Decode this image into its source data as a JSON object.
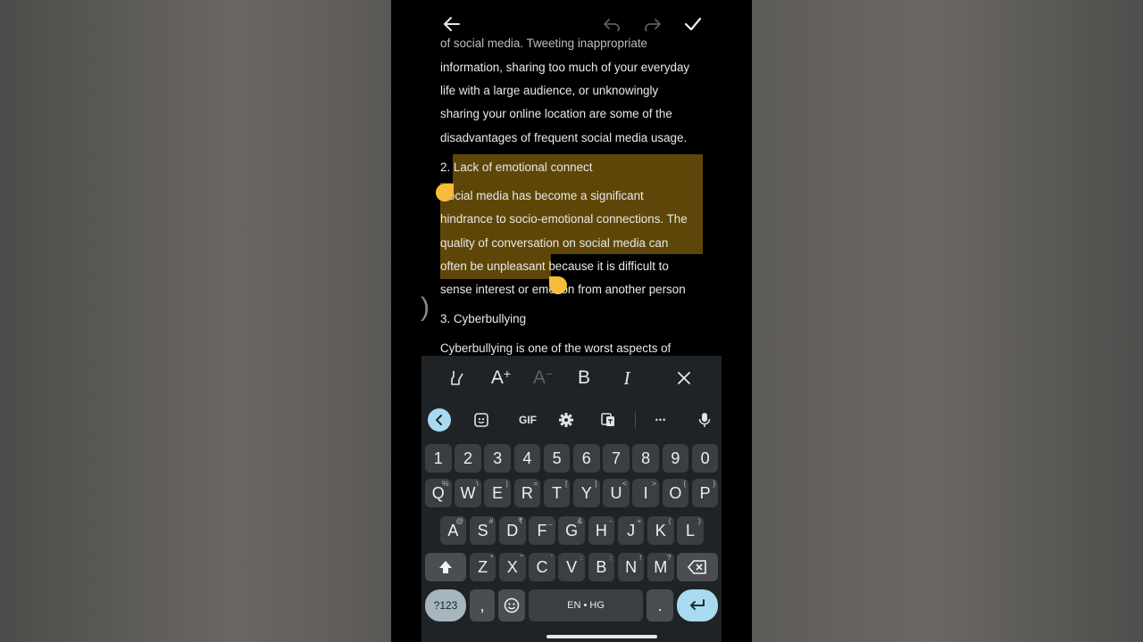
{
  "document": {
    "lines": [
      "of social media. Tweeting inappropriate",
      "information, sharing too much of your everyday",
      "life with a large audience, or unknowingly",
      "sharing your online location are some of the",
      "disadvantages of frequent social media usage.",
      "2. Lack of emotional connect",
      "Social media has become a significant",
      "hindrance to socio-emotional connections. The",
      "quality of conversation on social media can",
      "often be unpleasant because it is difficult to",
      "sense interest or emotion from another person",
      "3. Cyberbullying",
      "Cyberbullying is one of the worst aspects of"
    ],
    "cursor_glyph": ")"
  },
  "format_toolbar": {
    "increase_font": "A",
    "decrease_font": "A",
    "plus": "+",
    "minus": "−",
    "bold": "B",
    "italic": "I"
  },
  "suggestion_bar": {
    "gif_label": "GIF",
    "more_label": "•••"
  },
  "keyboard": {
    "number_row": [
      "1",
      "2",
      "3",
      "4",
      "5",
      "6",
      "7",
      "8",
      "9",
      "0"
    ],
    "row1": [
      {
        "key": "Q",
        "hint": "%"
      },
      {
        "key": "W",
        "hint": "\\"
      },
      {
        "key": "E",
        "hint": "|"
      },
      {
        "key": "R",
        "hint": "="
      },
      {
        "key": "T",
        "hint": "["
      },
      {
        "key": "Y",
        "hint": "]"
      },
      {
        "key": "U",
        "hint": "<"
      },
      {
        "key": "I",
        "hint": ">"
      },
      {
        "key": "O",
        "hint": "{"
      },
      {
        "key": "P",
        "hint": "}"
      }
    ],
    "row2": [
      {
        "key": "A",
        "hint": "@"
      },
      {
        "key": "S",
        "hint": "#"
      },
      {
        "key": "D",
        "hint": "₹"
      },
      {
        "key": "F",
        "hint": "_"
      },
      {
        "key": "G",
        "hint": "&"
      },
      {
        "key": "H",
        "hint": "-"
      },
      {
        "key": "J",
        "hint": "+"
      },
      {
        "key": "K",
        "hint": "("
      },
      {
        "key": "L",
        "hint": ")"
      }
    ],
    "row3": [
      {
        "key": "Z",
        "hint": "*"
      },
      {
        "key": "X",
        "hint": "\""
      },
      {
        "key": "C",
        "hint": "'"
      },
      {
        "key": "V",
        "hint": ":"
      },
      {
        "key": "B",
        "hint": ";"
      },
      {
        "key": "N",
        "hint": "!"
      },
      {
        "key": "M",
        "hint": "?"
      }
    ],
    "symbols_label": "?123",
    "comma_label": ",",
    "space_label": "EN • HG",
    "period_label": "."
  },
  "colors": {
    "highlight": "#5e4608",
    "handle": "#f6bd3a",
    "accent": "#a8dbf0",
    "key": "#3b3f42",
    "keyboard_bg": "#1f2326"
  }
}
